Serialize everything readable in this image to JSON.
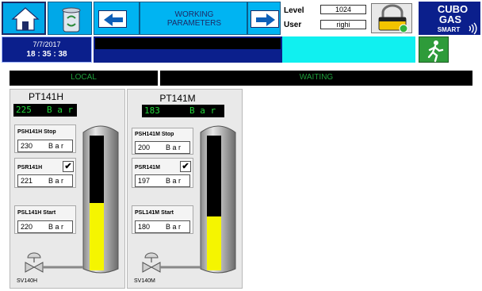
{
  "header": {
    "title_line1": "WORKING",
    "title_line2": "PARAMETERS",
    "date": "7/7/2017",
    "time": "18 : 35 : 38",
    "level_label": "Level",
    "level_value": "1024",
    "user_label": "User",
    "user_value": "righi",
    "brand_line1": "CUBO",
    "brand_line2": "GAS",
    "brand_line3": "SMART"
  },
  "status": {
    "mode": "LOCAL",
    "state": "WAITING"
  },
  "panels": [
    {
      "title": "PT141H",
      "value": "225",
      "unit": "B a r",
      "stop_label": "PSH141H Stop",
      "stop_value": "230",
      "psr_label": "PSR141H",
      "psr_value": "221",
      "psr_checked": "✔",
      "start_label": "PSL141H Start",
      "start_value": "220",
      "field_unit": "B a r",
      "valve": "SV140H",
      "fill_fraction": 0.5
    },
    {
      "title": "PT141M",
      "value": "183",
      "unit": "B a r",
      "stop_label": "PSH141M Stop",
      "stop_value": "200",
      "psr_label": "PSR141M",
      "psr_value": "197",
      "psr_checked": "✔",
      "start_label": "PSL141M Start",
      "start_value": "180",
      "field_unit": "B a r",
      "valve": "SV140M",
      "fill_fraction": 0.4
    }
  ],
  "colors": {
    "tile": "#00b4f2",
    "navy": "#0b1f8c",
    "cyan": "#10f0f0",
    "status_text": "#1f9f3b",
    "readout_text": "#21d63a",
    "tank_fill": "#f5f500"
  }
}
